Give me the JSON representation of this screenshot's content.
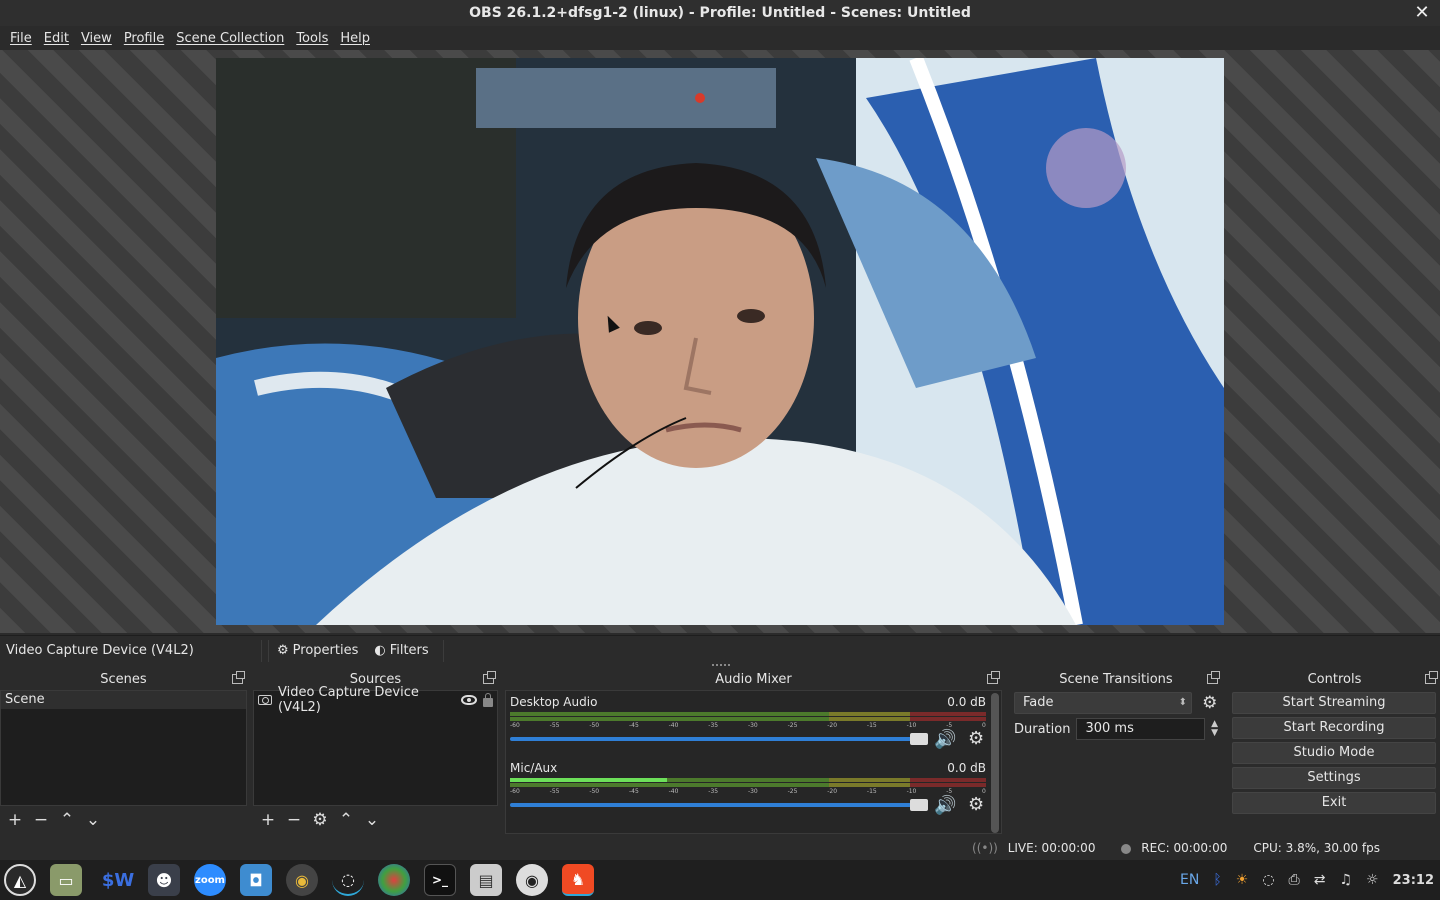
{
  "window": {
    "title": "OBS 26.1.2+dfsg1-2 (linux) - Profile: Untitled - Scenes: Untitled",
    "close_glyph": "✕"
  },
  "menu": [
    "File",
    "Edit",
    "View",
    "Profile",
    "Scene Collection",
    "Tools",
    "Help"
  ],
  "source_toolbar": {
    "selected_source": "Video Capture Device (V4L2)",
    "properties": "Properties",
    "filters": "Filters"
  },
  "scenes": {
    "title": "Scenes",
    "items": [
      "Scene"
    ]
  },
  "sources": {
    "title": "Sources",
    "items": [
      "Video Capture Device (V4L2)"
    ]
  },
  "mixer": {
    "title": "Audio Mixer",
    "channels": [
      {
        "name": "Desktop Audio",
        "db": "0.0 dB",
        "level": 0,
        "volume": 1.0
      },
      {
        "name": "Mic/Aux",
        "db": "0.0 dB",
        "level": 0.33,
        "volume": 1.0
      }
    ],
    "ticks": [
      "-60",
      "-55",
      "-50",
      "-45",
      "-40",
      "-35",
      "-30",
      "-25",
      "-20",
      "-15",
      "-10",
      "-5",
      "0"
    ]
  },
  "transitions": {
    "title": "Scene Transitions",
    "selected": "Fade",
    "duration_label": "Duration",
    "duration_value": "300 ms"
  },
  "controls": {
    "title": "Controls",
    "buttons": [
      "Start Streaming",
      "Start Recording",
      "Studio Mode",
      "Settings",
      "Exit"
    ]
  },
  "status": {
    "live": "LIVE: 00:00:00",
    "rec": "REC: 00:00:00",
    "cpu": "CPU: 3.8%, 30.00 fps"
  },
  "taskbar": {
    "apps": [
      "launcher-icon",
      "files-icon",
      "sw-icon",
      "mascot-icon",
      "zoom-icon",
      "camera-icon",
      "speaker-icon",
      "obs-icon",
      "color-icon",
      "terminal-icon",
      "archive-icon",
      "webcam-icon",
      "brave-icon"
    ],
    "zoom_label": "zoom",
    "sw_label": "$W",
    "tray_lang": "EN",
    "clock": "23:12"
  },
  "colors": {
    "accent": "#2f7fd6",
    "meter_green": "#4c7a2c",
    "meter_yellow": "#7a7a2a",
    "meter_red": "#7a2a2a"
  }
}
